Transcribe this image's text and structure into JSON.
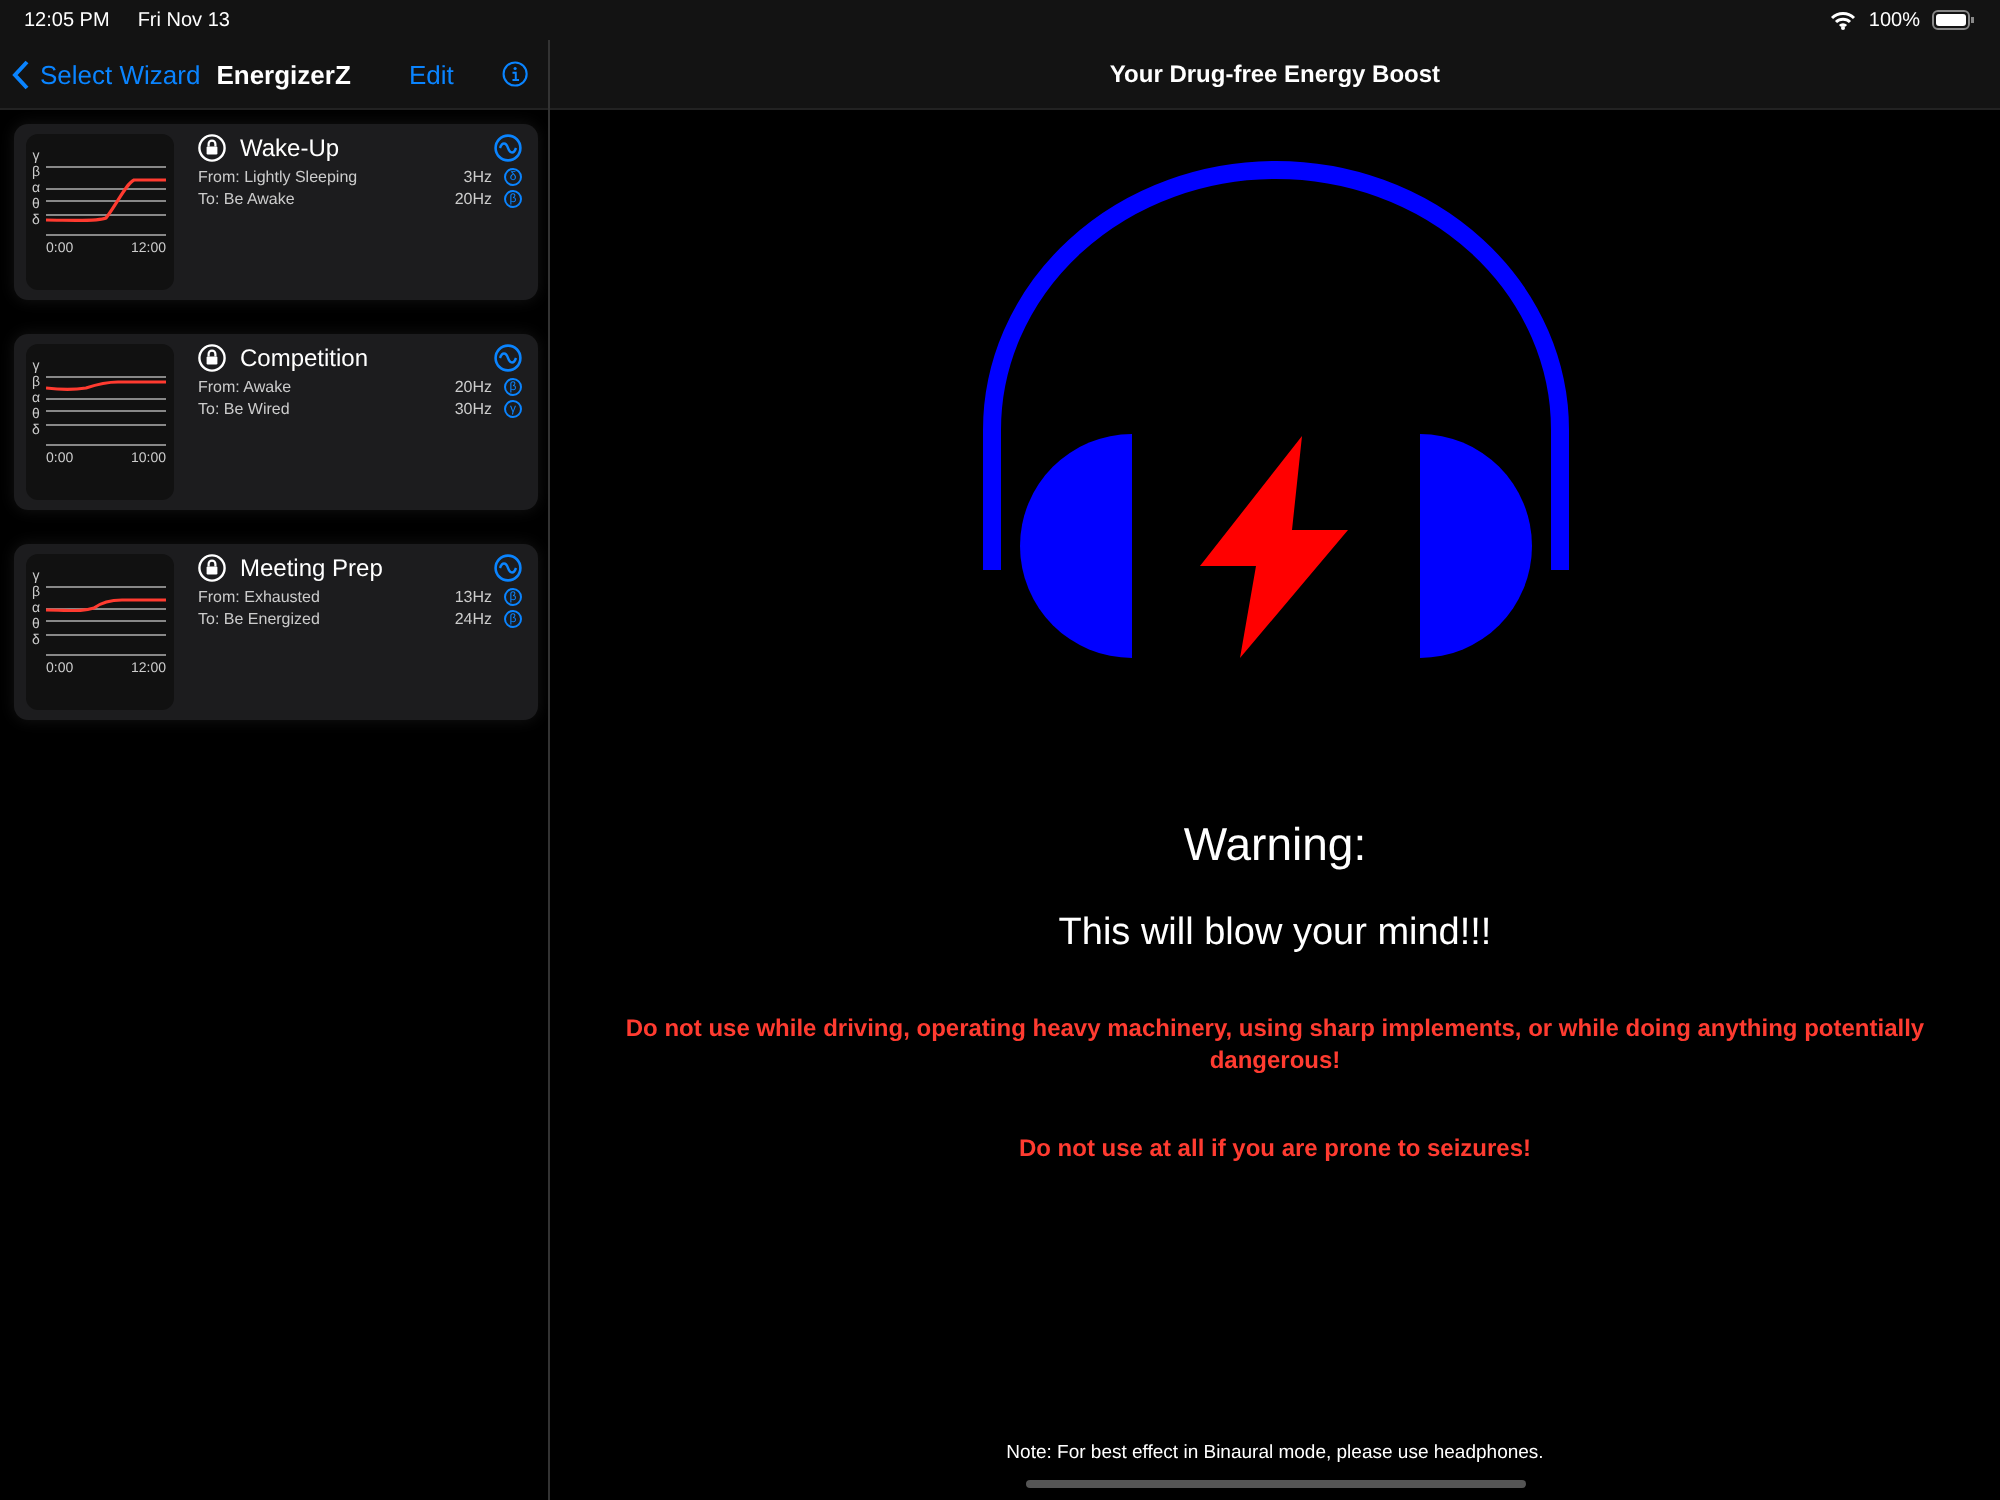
{
  "status_bar": {
    "time": "12:05 PM",
    "date": "Fri Nov 13",
    "battery": "100%"
  },
  "sidebar": {
    "back": "Select Wizard",
    "title": "EnergizerZ",
    "edit": "Edit",
    "cards": [
      {
        "title": "Wake-Up",
        "from": "From: Lightly Sleeping",
        "from_hz": "3Hz",
        "from_band": "δ",
        "to": "To: Be Awake",
        "to_hz": "20Hz",
        "to_band": "β",
        "axis": [
          "γ",
          "β",
          "α",
          "θ",
          "δ"
        ],
        "start_time": "0:00",
        "end_time": "12:00"
      },
      {
        "title": "Competition",
        "from": "From: Awake",
        "from_hz": "20Hz",
        "from_band": "β",
        "to": "To: Be Wired",
        "to_hz": "30Hz",
        "to_band": "γ",
        "axis": [
          "γ",
          "β",
          "α",
          "θ",
          "δ"
        ],
        "start_time": "0:00",
        "end_time": "10:00"
      },
      {
        "title": "Meeting Prep",
        "from": "From: Exhausted",
        "from_hz": "13Hz",
        "from_band": "β",
        "to": "To: Be Energized",
        "to_hz": "24Hz",
        "to_band": "β",
        "axis": [
          "γ",
          "β",
          "α",
          "θ",
          "δ"
        ],
        "start_time": "0:00",
        "end_time": "12:00"
      }
    ]
  },
  "detail": {
    "title": "Your Drug-free Energy Boost",
    "warning": "Warning:",
    "subtitle": "This will blow your mind!!!",
    "cautions": [
      "Do not use while driving, operating heavy machinery, using sharp implements, or while doing anything potentially dangerous!",
      "Do not use at all if you are prone to seizures!"
    ],
    "note": "Note: For best effect in Binaural mode, please use headphones."
  }
}
